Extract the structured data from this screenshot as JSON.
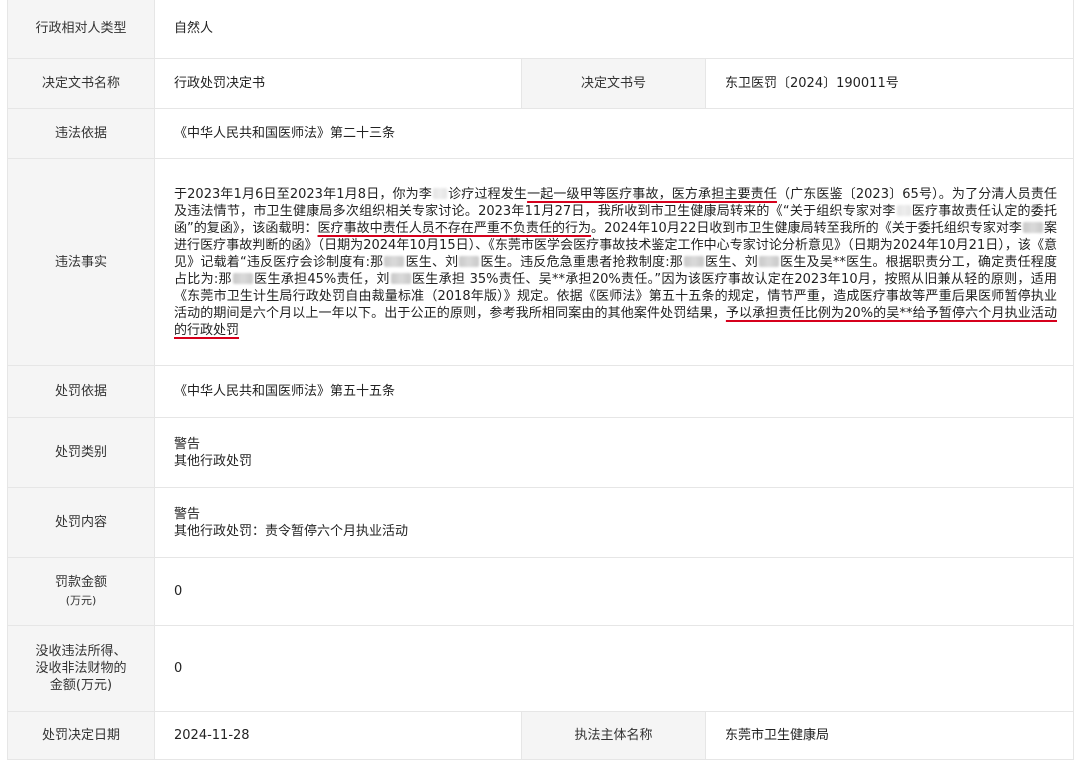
{
  "rows": {
    "party_type": {
      "label": "行政相对人类型",
      "value": "自然人"
    },
    "doc_name": {
      "label": "决定文书名称",
      "value": "行政处罚决定书"
    },
    "doc_no": {
      "label": "决定文书号",
      "value": "东卫医罚〔2024〕190011号"
    },
    "basis": {
      "label": "违法依据",
      "value": "《中华人民共和国医师法》第二十三条"
    },
    "facts_label": "违法事实",
    "penalty_basis": {
      "label": "处罚依据",
      "value": "《中华人民共和国医师法》第五十五条"
    },
    "penalty_type": {
      "label": "处罚类别",
      "lines": [
        "警告",
        "其他行政处罚"
      ]
    },
    "penalty_content": {
      "label": "处罚内容",
      "lines": [
        "警告",
        "其他行政处罚：责令暂停六个月执业活动"
      ]
    },
    "fine": {
      "label": "罚款金额",
      "sublabel": "(万元)",
      "value": "0"
    },
    "confiscation": {
      "label_lines": [
        "没收违法所得、",
        "没收非法财物的",
        "金额(万元)"
      ],
      "value": "0"
    },
    "decision_date": {
      "label": "处罚决定日期",
      "value": "2024-11-28"
    },
    "authority": {
      "label": "执法主体名称",
      "value": "东莞市卫生健康局"
    }
  },
  "facts": {
    "s01": "于2023年1月6日至2023年1月8日，你为李",
    "s02": "诊疗过程发生",
    "s03": "一起一级甲等医疗事故，医方承担主要责任",
    "s04": "（广东医鉴〔2023〕65号）。为了分清人员责任及违法情节，市卫生健康局多次组织相关专家讨论。2023年11月27日，我所收到市卫生健康局转来的《“关于组织专家对李",
    "s05": "医疗事故责任认定的委托函”的复函》，该函载明：",
    "s06": "医疗事故中责任人员不存在严重不负责任的行为",
    "s07": "。2024年10月22日收到市卫生健康局转至我所的《关于委托组织专家对李",
    "s08": "案进行医疗事故判断的函》（日期为2024年10月15日）、《东莞市医学会医疗事故技术鉴定工作中心专家讨论分析意见》（日期为2024年10月21日），该《意见》记载着“违反医疗会诊制度有:那",
    "s09": "医生、刘",
    "s10": "医生。违反危急重患者抢救制度:那",
    "s11": "医生、刘",
    "s12": "医生及吴**医生。根据职责分工，确定责任程度占比为:那",
    "s13": "医生承担45%责任，刘",
    "s14": "医生承担 35%责任、吴**承担20%责任。”因为该医疗事故认定在2023年10月，按照从旧兼从轻的原则，适用《东莞市卫生计生局行政处罚自由裁量标准（2018年版）》规定。依据《医师法》第五十五条的规定，情节严重，造成医疗事故等严重后果医师暂停执业活动的期间是六个月以上一年以下。出于公正的原则，参考我所相同案由的其他案件处罚结果，",
    "s15": "予以承担责任比例为20%的吴**给予暂停六个月执业活动的行政处罚"
  },
  "colors": {
    "label_bg": "#f5f5f5",
    "border": "#e6e6e6",
    "underline": "#d6001c",
    "text": "#222222"
  }
}
